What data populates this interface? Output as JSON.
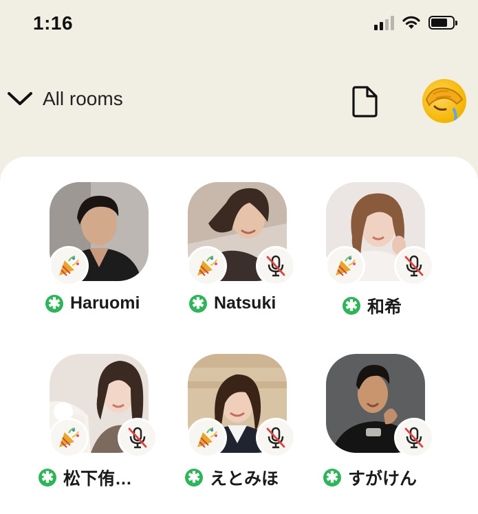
{
  "status_bar": {
    "time": "1:16"
  },
  "header": {
    "back_label": "All rooms"
  },
  "speakers": [
    {
      "name": "Haruomi",
      "muted": false
    },
    {
      "name": "Natsuki",
      "muted": true
    },
    {
      "name": "和希",
      "muted": true
    },
    {
      "name": "松下侑…",
      "muted": true
    },
    {
      "name": "えとみほ",
      "muted": true
    },
    {
      "name": "すがけん",
      "muted": true
    }
  ],
  "colors": {
    "background": "#f1efe4",
    "sheet": "#ffffff",
    "moderator_badge": "#2fb45a"
  },
  "icons": {
    "back": "chevron-down-icon",
    "document": "document-icon",
    "moderator": "moderator-asterisk-icon",
    "party": "party-popper-icon",
    "muted": "muted-mic-icon"
  }
}
